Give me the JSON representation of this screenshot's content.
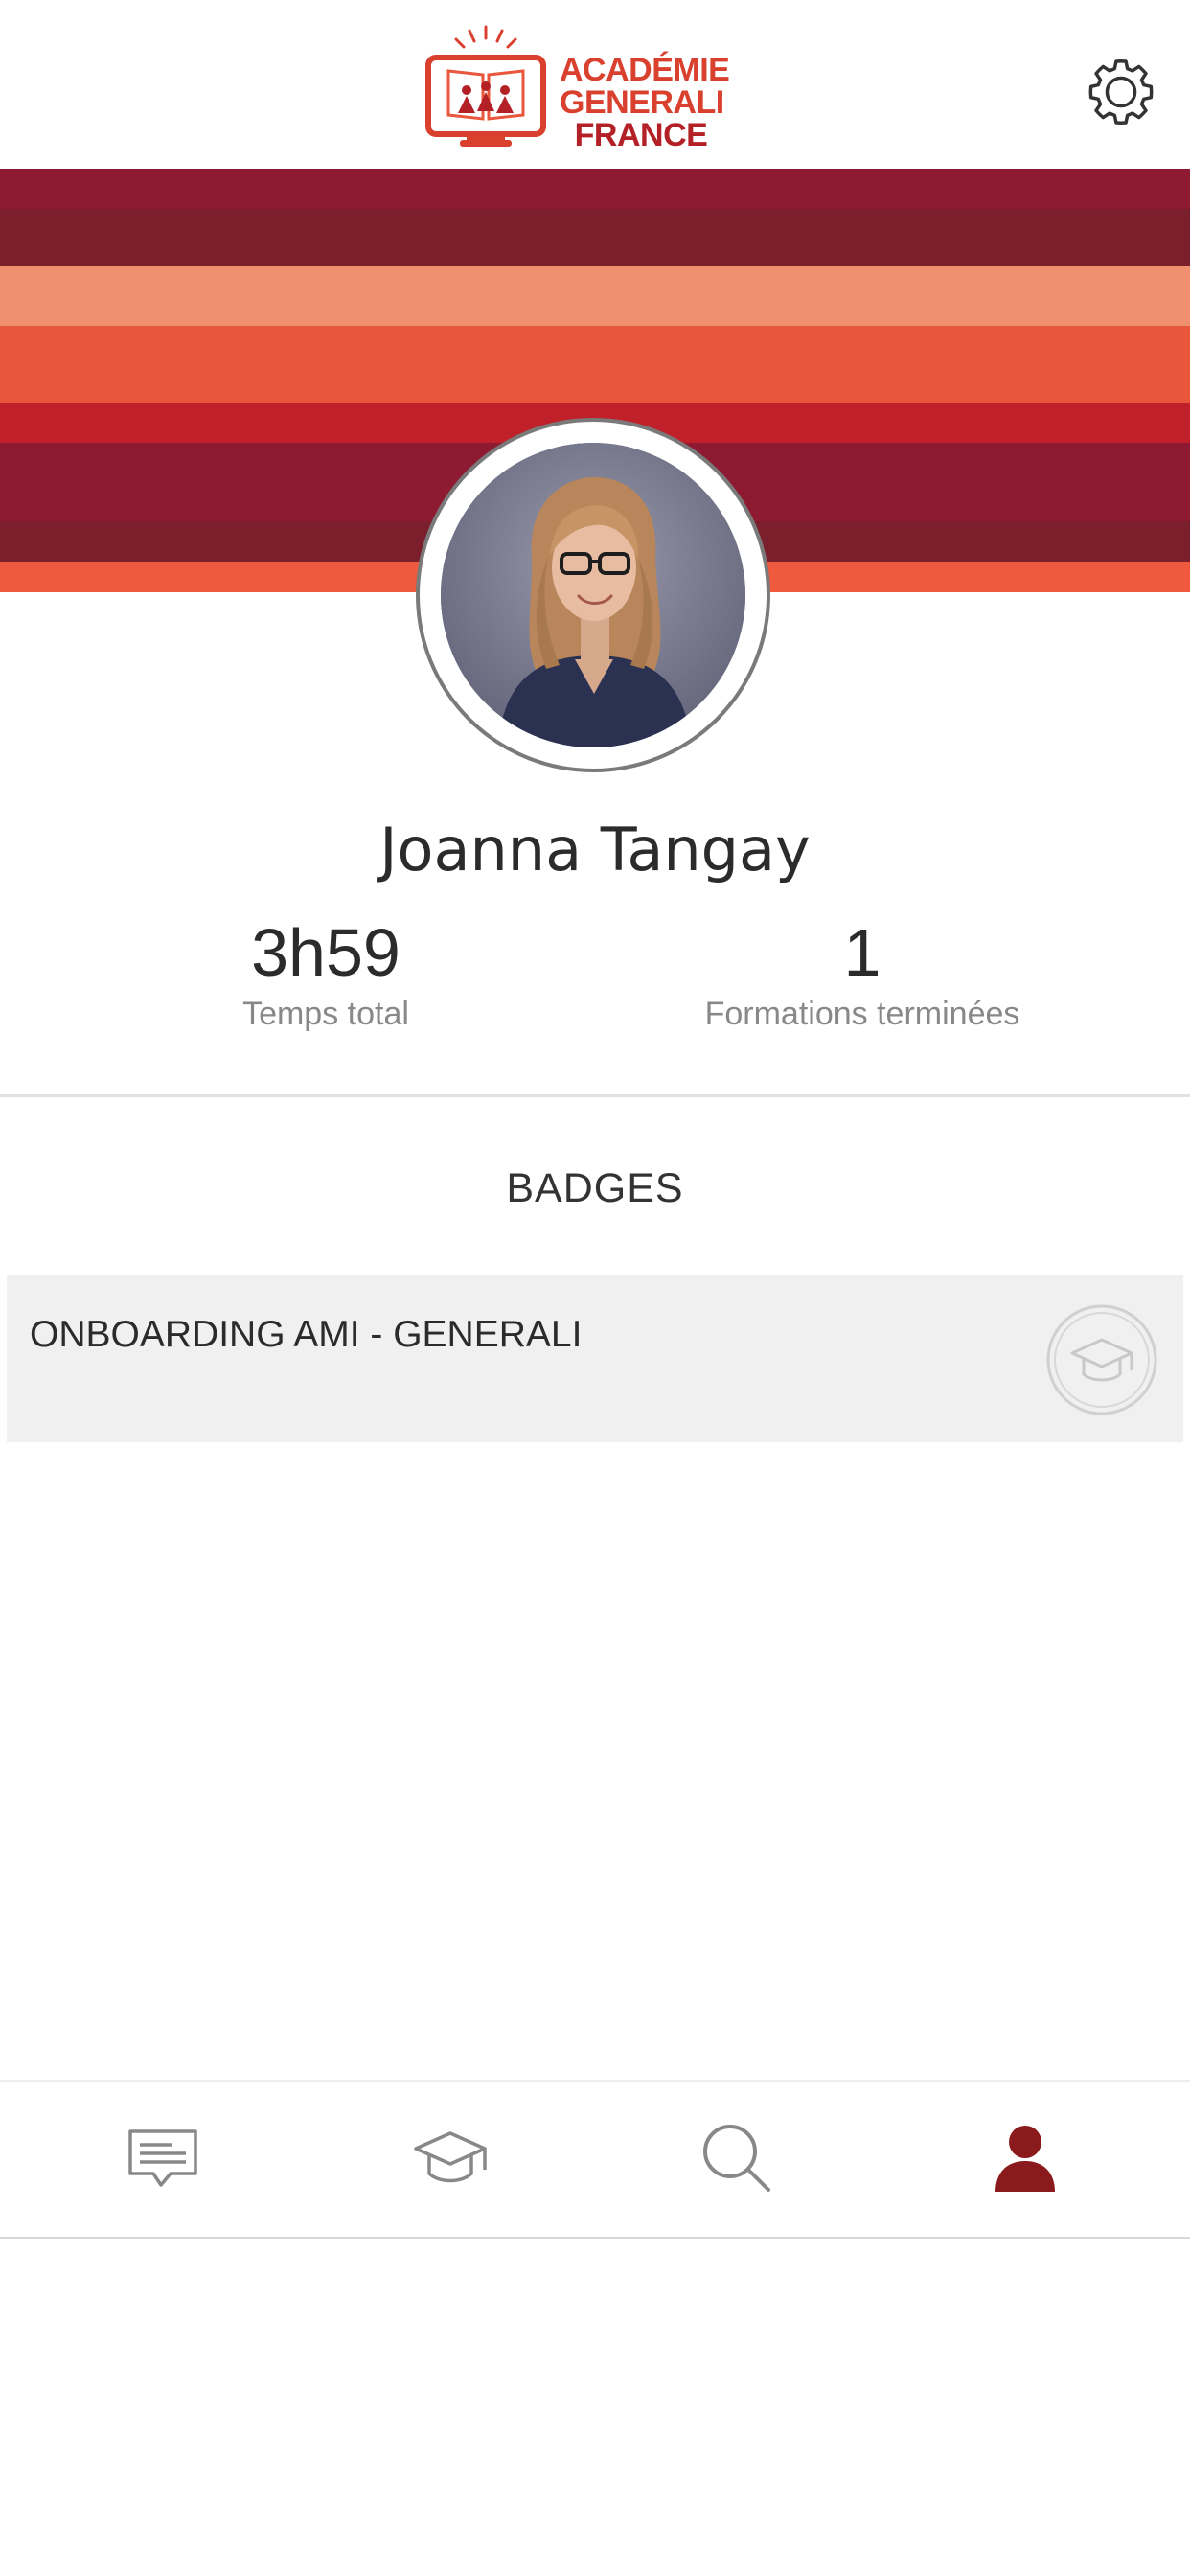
{
  "header": {
    "logo": {
      "line1": "ACADÉMIE",
      "line2": "GENERALI",
      "line3": "FRANCE"
    },
    "settings_icon": "gear-icon"
  },
  "banner": {
    "stripe_colors": [
      "#8e1a32",
      "#7a1f2b",
      "#f0906f",
      "#e8573c",
      "#c0202a",
      "#8e1a32",
      "#7a1f2b",
      "#ef5a3e"
    ]
  },
  "profile": {
    "name": "Joanna Tangay",
    "stats": [
      {
        "value": "3h59",
        "label": "Temps total"
      },
      {
        "value": "1",
        "label": "Formations terminées"
      }
    ]
  },
  "badges": {
    "title": "BADGES",
    "items": [
      {
        "name": "ONBOARDING AMI - GENERALI",
        "icon": "graduation-cap-icon"
      }
    ]
  },
  "bottom_nav": {
    "items": [
      {
        "icon": "message-icon",
        "active": false
      },
      {
        "icon": "graduation-cap-icon",
        "active": false
      },
      {
        "icon": "search-icon",
        "active": false
      },
      {
        "icon": "user-icon",
        "active": true
      }
    ],
    "active_color": "#8b1a1d",
    "inactive_color": "#888888"
  },
  "colors": {
    "brand_red": "#d9402e",
    "dark_red": "#8b1a1d"
  }
}
